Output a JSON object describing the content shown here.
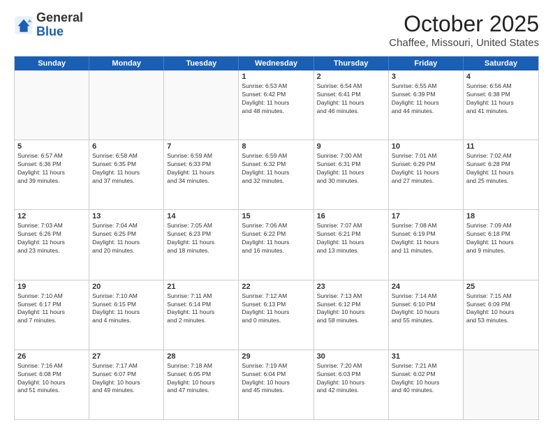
{
  "logo": {
    "general": "General",
    "blue": "Blue"
  },
  "header": {
    "month": "October 2025",
    "location": "Chaffee, Missouri, United States"
  },
  "weekdays": [
    "Sunday",
    "Monday",
    "Tuesday",
    "Wednesday",
    "Thursday",
    "Friday",
    "Saturday"
  ],
  "rows": [
    [
      {
        "day": "",
        "info": ""
      },
      {
        "day": "",
        "info": ""
      },
      {
        "day": "",
        "info": ""
      },
      {
        "day": "1",
        "info": "Sunrise: 6:53 AM\nSunset: 6:42 PM\nDaylight: 11 hours\nand 48 minutes."
      },
      {
        "day": "2",
        "info": "Sunrise: 6:54 AM\nSunset: 6:41 PM\nDaylight: 11 hours\nand 46 minutes."
      },
      {
        "day": "3",
        "info": "Sunrise: 6:55 AM\nSunset: 6:39 PM\nDaylight: 11 hours\nand 44 minutes."
      },
      {
        "day": "4",
        "info": "Sunrise: 6:56 AM\nSunset: 6:38 PM\nDaylight: 11 hours\nand 41 minutes."
      }
    ],
    [
      {
        "day": "5",
        "info": "Sunrise: 6:57 AM\nSunset: 6:36 PM\nDaylight: 11 hours\nand 39 minutes."
      },
      {
        "day": "6",
        "info": "Sunrise: 6:58 AM\nSunset: 6:35 PM\nDaylight: 11 hours\nand 37 minutes."
      },
      {
        "day": "7",
        "info": "Sunrise: 6:59 AM\nSunset: 6:33 PM\nDaylight: 11 hours\nand 34 minutes."
      },
      {
        "day": "8",
        "info": "Sunrise: 6:59 AM\nSunset: 6:32 PM\nDaylight: 11 hours\nand 32 minutes."
      },
      {
        "day": "9",
        "info": "Sunrise: 7:00 AM\nSunset: 6:31 PM\nDaylight: 11 hours\nand 30 minutes."
      },
      {
        "day": "10",
        "info": "Sunrise: 7:01 AM\nSunset: 6:29 PM\nDaylight: 11 hours\nand 27 minutes."
      },
      {
        "day": "11",
        "info": "Sunrise: 7:02 AM\nSunset: 6:28 PM\nDaylight: 11 hours\nand 25 minutes."
      }
    ],
    [
      {
        "day": "12",
        "info": "Sunrise: 7:03 AM\nSunset: 6:26 PM\nDaylight: 11 hours\nand 23 minutes."
      },
      {
        "day": "13",
        "info": "Sunrise: 7:04 AM\nSunset: 6:25 PM\nDaylight: 11 hours\nand 20 minutes."
      },
      {
        "day": "14",
        "info": "Sunrise: 7:05 AM\nSunset: 6:23 PM\nDaylight: 11 hours\nand 18 minutes."
      },
      {
        "day": "15",
        "info": "Sunrise: 7:06 AM\nSunset: 6:22 PM\nDaylight: 11 hours\nand 16 minutes."
      },
      {
        "day": "16",
        "info": "Sunrise: 7:07 AM\nSunset: 6:21 PM\nDaylight: 11 hours\nand 13 minutes."
      },
      {
        "day": "17",
        "info": "Sunrise: 7:08 AM\nSunset: 6:19 PM\nDaylight: 11 hours\nand 11 minutes."
      },
      {
        "day": "18",
        "info": "Sunrise: 7:09 AM\nSunset: 6:18 PM\nDaylight: 11 hours\nand 9 minutes."
      }
    ],
    [
      {
        "day": "19",
        "info": "Sunrise: 7:10 AM\nSunset: 6:17 PM\nDaylight: 11 hours\nand 7 minutes."
      },
      {
        "day": "20",
        "info": "Sunrise: 7:10 AM\nSunset: 6:15 PM\nDaylight: 11 hours\nand 4 minutes."
      },
      {
        "day": "21",
        "info": "Sunrise: 7:11 AM\nSunset: 6:14 PM\nDaylight: 11 hours\nand 2 minutes."
      },
      {
        "day": "22",
        "info": "Sunrise: 7:12 AM\nSunset: 6:13 PM\nDaylight: 11 hours\nand 0 minutes."
      },
      {
        "day": "23",
        "info": "Sunrise: 7:13 AM\nSunset: 6:12 PM\nDaylight: 10 hours\nand 58 minutes."
      },
      {
        "day": "24",
        "info": "Sunrise: 7:14 AM\nSunset: 6:10 PM\nDaylight: 10 hours\nand 55 minutes."
      },
      {
        "day": "25",
        "info": "Sunrise: 7:15 AM\nSunset: 6:09 PM\nDaylight: 10 hours\nand 53 minutes."
      }
    ],
    [
      {
        "day": "26",
        "info": "Sunrise: 7:16 AM\nSunset: 6:08 PM\nDaylight: 10 hours\nand 51 minutes."
      },
      {
        "day": "27",
        "info": "Sunrise: 7:17 AM\nSunset: 6:07 PM\nDaylight: 10 hours\nand 49 minutes."
      },
      {
        "day": "28",
        "info": "Sunrise: 7:18 AM\nSunset: 6:05 PM\nDaylight: 10 hours\nand 47 minutes."
      },
      {
        "day": "29",
        "info": "Sunrise: 7:19 AM\nSunset: 6:04 PM\nDaylight: 10 hours\nand 45 minutes."
      },
      {
        "day": "30",
        "info": "Sunrise: 7:20 AM\nSunset: 6:03 PM\nDaylight: 10 hours\nand 42 minutes."
      },
      {
        "day": "31",
        "info": "Sunrise: 7:21 AM\nSunset: 6:02 PM\nDaylight: 10 hours\nand 40 minutes."
      },
      {
        "day": "",
        "info": ""
      }
    ]
  ]
}
